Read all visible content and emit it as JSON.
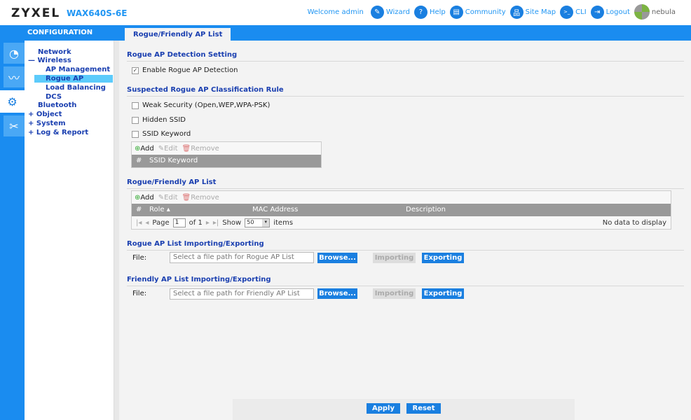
{
  "header": {
    "brand": "ZYXEL",
    "model": "WAX640S-6E",
    "welcome": "Welcome admin",
    "links": [
      {
        "label": "Wizard",
        "icon": "wizard-icon",
        "glyph": "✎"
      },
      {
        "label": "Help",
        "icon": "help-icon",
        "glyph": "?"
      },
      {
        "label": "Community",
        "icon": "community-icon",
        "glyph": "▤"
      },
      {
        "label": "Site Map",
        "icon": "sitemap-icon",
        "glyph": "品"
      },
      {
        "label": "CLI",
        "icon": "cli-icon",
        "glyph": ">_"
      },
      {
        "label": "Logout",
        "icon": "logout-icon",
        "glyph": "⇥"
      }
    ],
    "nebula": "nebula"
  },
  "sidebar": {
    "title": "CONFIGURATION",
    "items": [
      "Network",
      "Wireless",
      "AP Management",
      "Rogue AP",
      "Load Balancing",
      "DCS",
      "Bluetooth",
      "Object",
      "System",
      "Log & Report"
    ]
  },
  "tab": "Rogue/Friendly AP List",
  "detection": {
    "title": "Rogue AP Detection Setting",
    "enable_label": "Enable Rogue AP Detection",
    "enabled": true
  },
  "classification": {
    "title": "Suspected Rogue AP Classification Rule",
    "rules": [
      {
        "label": "Weak Security (Open,WEP,WPA-PSK)",
        "checked": false
      },
      {
        "label": "Hidden SSID",
        "checked": false
      },
      {
        "label": "SSID Keyword",
        "checked": false
      }
    ],
    "toolbar": {
      "add": "Add",
      "edit": "Edit",
      "remove": "Remove"
    },
    "columns": [
      "#",
      "SSID Keyword"
    ]
  },
  "aplist": {
    "title": "Rogue/Friendly AP List",
    "toolbar": {
      "add": "Add",
      "edit": "Edit",
      "remove": "Remove"
    },
    "columns": [
      "#",
      "Role ▴",
      "MAC Address",
      "Description"
    ],
    "pager": {
      "page_label": "Page",
      "page": "1",
      "of": "of 1",
      "show": "Show",
      "per_page": "50",
      "items": "items",
      "empty": "No data to display"
    }
  },
  "rogue_io": {
    "title": "Rogue AP List Importing/Exporting",
    "file_label": "File:",
    "placeholder": "Select a file path for Rogue AP List",
    "browse": "Browse...",
    "import": "Importing",
    "export": "Exporting"
  },
  "friendly_io": {
    "title": "Friendly AP List Importing/Exporting",
    "file_label": "File:",
    "placeholder": "Select a file path for Friendly AP List",
    "browse": "Browse...",
    "import": "Importing",
    "export": "Exporting"
  },
  "footer": {
    "apply": "Apply",
    "reset": "Reset"
  }
}
